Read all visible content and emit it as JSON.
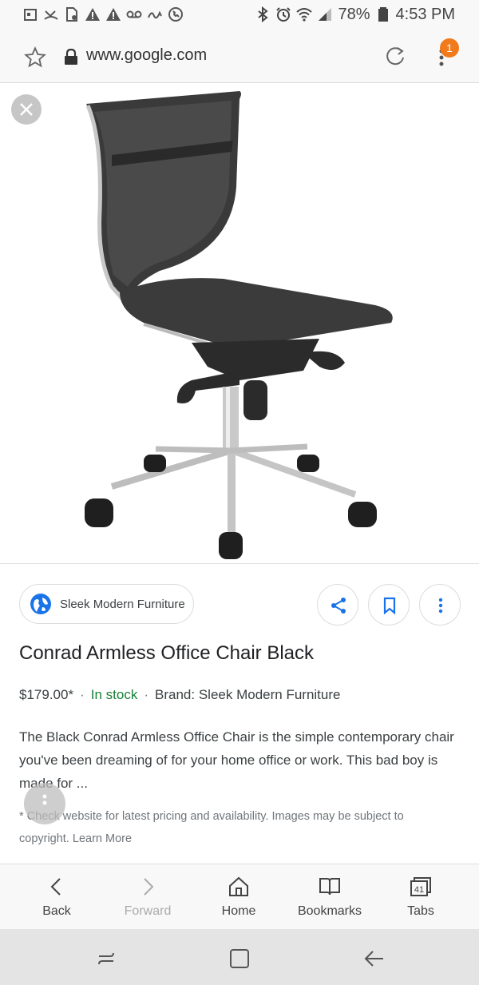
{
  "status_bar": {
    "battery": "78%",
    "time": "4:53 PM"
  },
  "address_bar": {
    "url": "www.google.com",
    "notification_count": "1"
  },
  "product": {
    "image_alt": "Office chair",
    "source_name": "Sleek Modern Furniture",
    "title": "Conrad Armless Office Chair Black",
    "price": "$179.00*",
    "separator": "·",
    "stock": "In stock",
    "brand": "Brand: Sleek Modern Furniture",
    "description": "The Black Conrad Armless Office Chair is the simple contemporary chair you've been dreaming of for your home office or work. This bad boy is made for ...",
    "disclaimer_prefix": "* Check website for latest pricing and availability. Images may be subject to copyright.",
    "learn_more": "Learn More"
  },
  "bottom_nav": {
    "back": "Back",
    "forward": "Forward",
    "home": "Home",
    "bookmarks": "Bookmarks",
    "tabs": "Tabs",
    "tab_count": "41"
  },
  "colors": {
    "accent_orange": "#f07a1c",
    "google_blue": "#1a73e8",
    "stock_green": "#188038"
  }
}
